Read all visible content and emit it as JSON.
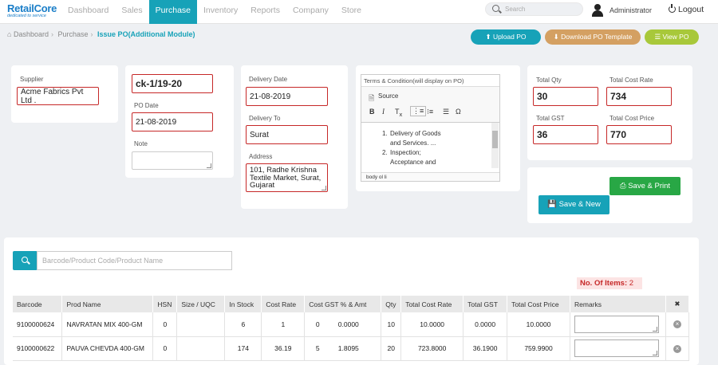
{
  "app": {
    "logo": "RetailCore",
    "tagline": "dedicated to service"
  },
  "nav": [
    "Dashboard",
    "Sales",
    "Purchase",
    "Inventory",
    "Reports",
    "Company",
    "Store"
  ],
  "search_placeholder": "Search",
  "user": "Administrator",
  "logout": "Logout",
  "breadcrumb": {
    "home": "Dashboard",
    "parent": "Purchase",
    "current": "Issue PO(Additional Module)"
  },
  "buttons": {
    "upload": "Upload PO",
    "download": "Download PO Template",
    "view": "View PO",
    "save_print": "Save & Print",
    "save_new": "Save & New"
  },
  "colors": {
    "primary": "#17a2b8",
    "download": "#d4a062",
    "view": "#a8c83a",
    "save_print": "#28a745",
    "error": "#c62828"
  },
  "supplier": {
    "label": "Supplier",
    "value": "Acme Fabrics Pvt Ltd ."
  },
  "po": {
    "number": "ck-1/19-20",
    "date_label": "PO Date",
    "date": "21-08-2019",
    "note_label": "Note"
  },
  "delivery": {
    "date_label": "Delivery Date",
    "date": "21-08-2019",
    "to_label": "Delivery To",
    "to": "Surat",
    "address_label": "Address",
    "address": "101, Radhe Krishna Textile Market, Surat, Gujarat"
  },
  "terms": {
    "title": "Terms & Condition(will display on PO)",
    "source": "Source",
    "items": [
      "Delivery of Goods and Services. ...",
      "Inspection; Acceptance and Rejection. ..."
    ],
    "footer": "body  ol  li"
  },
  "totals": {
    "qty_label": "Total Qty",
    "qty": "30",
    "cost_rate_label": "Total Cost Rate",
    "cost_rate": "734",
    "gst_label": "Total GST",
    "gst": "36",
    "cost_price_label": "Total Cost Price",
    "cost_price": "770"
  },
  "product_search_placeholder": "Barcode/Product Code/Product Name",
  "items_count": {
    "label": "No. Of Items:",
    "value": "2"
  },
  "table": {
    "headers": [
      "Barcode",
      "Prod Name",
      "HSN",
      "Size / UQC",
      "In Stock",
      "Cost Rate",
      "Cost GST % & Amt",
      "Qty",
      "Total Cost Rate",
      "Total GST",
      "Total Cost Price",
      "Remarks",
      "✖"
    ],
    "rows": [
      {
        "barcode": "9100000624",
        "name": "NAVRATAN MIX 400-GM",
        "hsn": "0",
        "size": "",
        "stock": "6",
        "rate": "1",
        "gst_pct": "0",
        "gst_amt": "0.0000",
        "qty": "10",
        "total_rate": "10.0000",
        "total_gst": "0.0000",
        "total_price": "10.0000"
      },
      {
        "barcode": "9100000622",
        "name": "PAUVA CHEVDA 400-GM",
        "hsn": "0",
        "size": "",
        "stock": "174",
        "rate": "36.19",
        "gst_pct": "5",
        "gst_amt": "1.8095",
        "qty": "20",
        "total_rate": "723.8000",
        "total_gst": "36.1900",
        "total_price": "759.9900"
      }
    ]
  }
}
